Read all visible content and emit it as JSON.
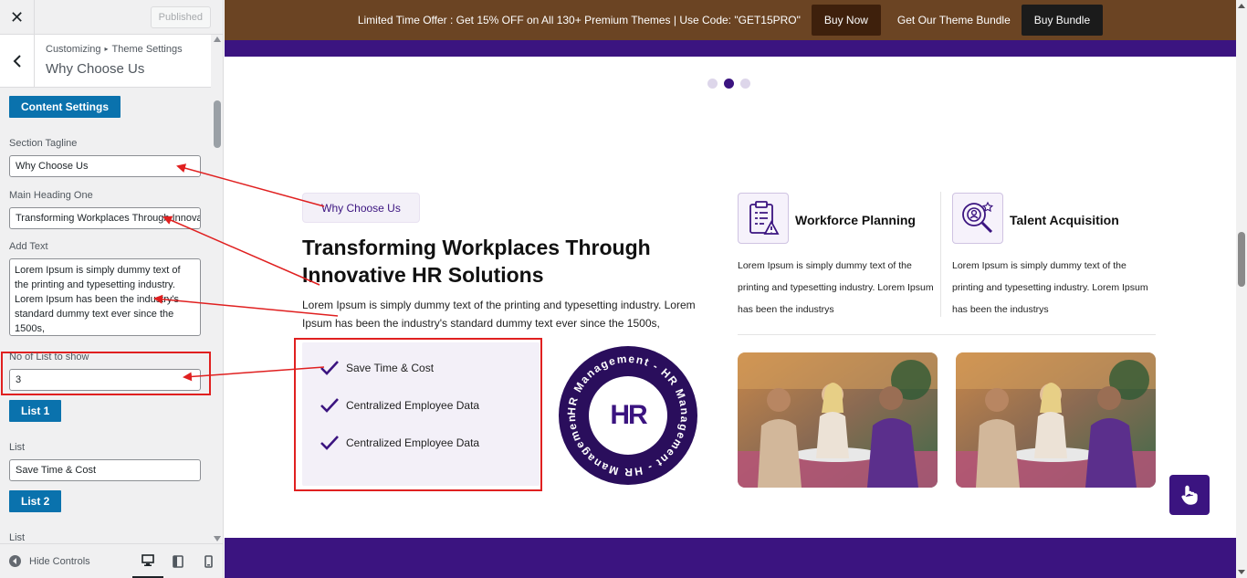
{
  "customizer": {
    "close_icon": "close-icon",
    "published_label": "Published",
    "breadcrumb": {
      "root": "Customizing",
      "parent": "Theme Settings"
    },
    "section_title": "Why Choose Us",
    "content_settings_label": "Content Settings",
    "fields": {
      "tagline_label": "Section Tagline",
      "tagline_value": "Why Choose Us",
      "heading_label": "Main Heading One",
      "heading_value": "Transforming Workplaces Through Innovative HR Solutions",
      "text_label": "Add Text",
      "text_value": "Lorem Ipsum is simply dummy text of the printing and typesetting industry. Lorem Ipsum has been the industry's standard dummy text ever since the 1500s,",
      "list_count_label": "No of List to show",
      "list_count_value": "3",
      "list1_button": "List 1",
      "list1_label": "List",
      "list1_value": "Save Time & Cost",
      "list2_button": "List 2",
      "list2_label": "List"
    },
    "footer": {
      "hide_controls_label": "Hide Controls"
    }
  },
  "preview": {
    "promo": {
      "text": "Limited Time Offer : Get 15% OFF on All 130+ Premium Themes | Use Code: \"GET15PRO\"",
      "buy_now": "Buy Now",
      "bundle_text": "Get Our Theme Bundle",
      "buy_bundle": "Buy Bundle"
    },
    "section": {
      "tagline": "Why Choose Us",
      "heading": "Transforming Workplaces Through Innovative HR Solutions",
      "text": "Lorem Ipsum is simply dummy text of the printing and typesetting industry. Lorem Ipsum has been the industry's standard dummy text ever since the 1500s,",
      "list": [
        "Save Time & Cost",
        "Centralized Employee Data",
        "Centralized Employee Data"
      ],
      "badge_center": "HR",
      "badge_ring_text": "HR Management - HR Management - HR Management - "
    },
    "features": [
      {
        "title": "Workforce Planning",
        "text": "Lorem Ipsum is simply dummy text of the printing and typesetting industry. Lorem Ipsum has been the industrys"
      },
      {
        "title": "Talent Acquisition",
        "text": "Lorem Ipsum is simply dummy text of the printing and typesetting industry. Lorem Ipsum has been the industrys"
      }
    ]
  },
  "colors": {
    "accent": "#3b1480",
    "wp_button": "#0a72ad",
    "promo_bg": "#6b4423",
    "annotation": "#e02020"
  }
}
